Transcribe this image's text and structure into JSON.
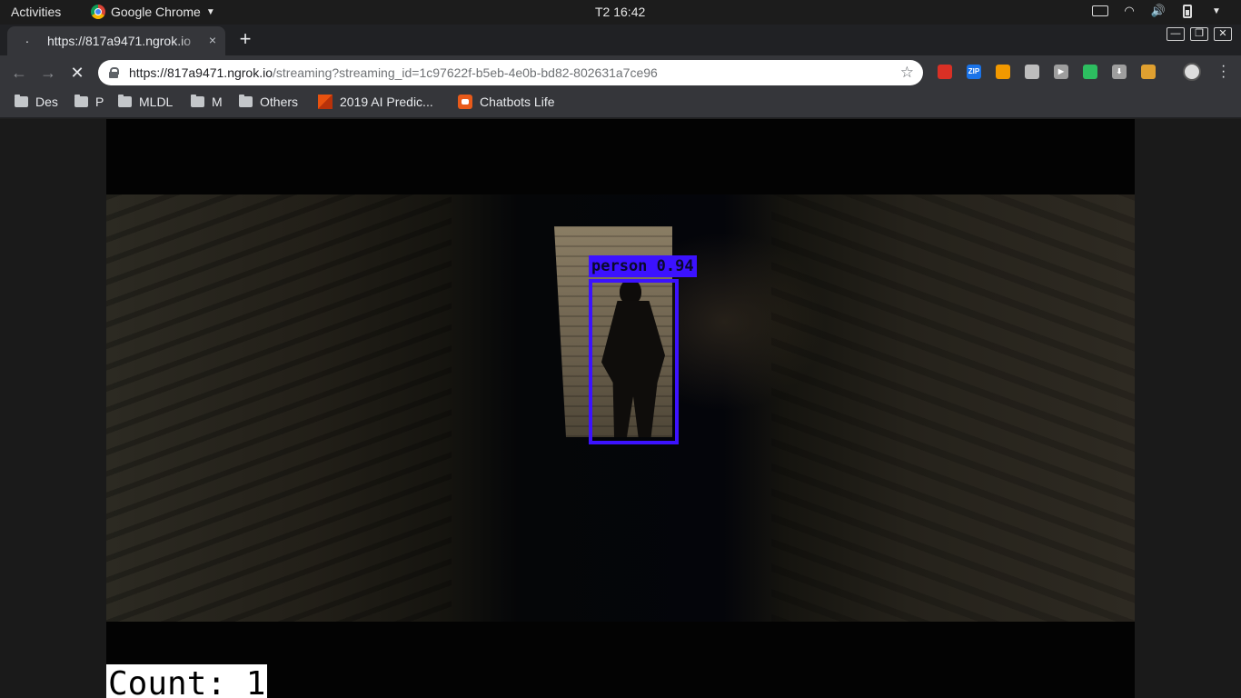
{
  "topbar": {
    "activities": "Activities",
    "app_name": "Google Chrome",
    "clock": "T2 16:42"
  },
  "tab": {
    "title": "https://817a9471.ngrok.io",
    "close": "×"
  },
  "newtab": "+",
  "window_controls": {
    "minimize": "—",
    "restore": "❐",
    "close": "✕"
  },
  "toolbar": {
    "url_host": "https://817a9471.ngrok.io",
    "url_rest": "/streaming?streaming_id=1c97622f-b5eb-4e0b-bd82-802631a7ce96",
    "star": "☆"
  },
  "extensions": [
    {
      "name": "stop-extension-icon",
      "label": "",
      "color": "#d93025"
    },
    {
      "name": "zip-extension-icon",
      "label": "ZIP",
      "color": "#1a73e8"
    },
    {
      "name": "owl-extension-icon",
      "label": "",
      "color": "#f29900"
    },
    {
      "name": "page-extension-icon",
      "label": "",
      "color": "#bdbdbd"
    },
    {
      "name": "play-extension-icon",
      "label": "▶",
      "color": "#9e9e9e"
    },
    {
      "name": "evernote-extension-icon",
      "label": "",
      "color": "#2dbe60"
    },
    {
      "name": "download-extension-icon",
      "label": "⬇",
      "color": "#9e9e9e"
    },
    {
      "name": "cookie-extension-icon",
      "label": "",
      "color": "#e0a030"
    }
  ],
  "bookmarks": [
    {
      "label": "Des",
      "type": "folder"
    },
    {
      "label": "P",
      "type": "folder"
    },
    {
      "label": "MLDL",
      "type": "folder"
    },
    {
      "label": "M",
      "type": "folder"
    },
    {
      "label": "Others",
      "type": "folder"
    },
    {
      "label": "2019 AI Predic...",
      "type": "site"
    },
    {
      "label": "Chatbots Life",
      "type": "site"
    }
  ],
  "stream": {
    "detection_label": "person 0.94",
    "count_text": "Count: 1",
    "box_color": "#3c12ff"
  }
}
